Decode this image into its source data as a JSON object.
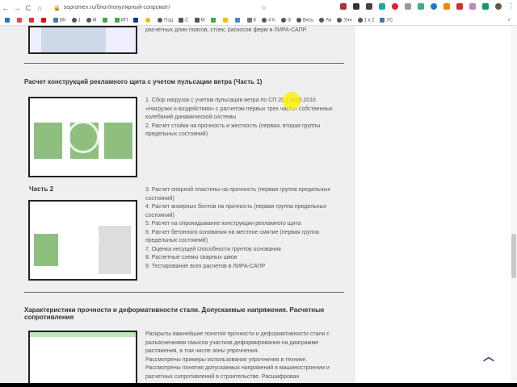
{
  "browser": {
    "url": "sopromex.ru/блог/популярный-сопромат/",
    "bookmarks": [
      "ВК",
      "J",
      "M",
      "ИП",
      "Под",
      "С",
      "М",
      "К",
      "4 К",
      "Э",
      "Весь",
      "Ав",
      "Унн",
      "1 к 2",
      "УС"
    ]
  },
  "sections": [
    {
      "tail_text": "расчетных длин поясов, стоек, раскосов ферм в ЛИРА-САПР."
    },
    {
      "title": "Расчет конструкций рекламного щита с учетом пульсации ветра (Часть 1)",
      "part1": [
        "1. Сбор нагрузок с учетом пульсации ветра по СП 20.13330.2016 «Нагрузки и воздействия» с расчетом первых трех частот собственных колебаний динамической системы",
        "2. Расчет стойки на прочность и жесткость (первая, вторая группы предельных состояний)"
      ],
      "part2_label": "Часть 2",
      "part2": [
        "3. Расчет опорной пластины на прочность (первая группа предельных состояний)",
        "4. Расчет анкерных болтов на прочность (первая группа предельных состояний)",
        "5. Расчет на опрокидывание конструкции рекламного щита",
        "6. Расчет бетонного основания на местное смятие (первая группа предельных состояний)",
        "7. Оценка несущей способности грунтов основания",
        "8. Расчетные схемы сварных швов",
        "9. Тестирование всех расчетов в ЛИРА-САПР"
      ]
    },
    {
      "title": "Характеристики прочности и деформативности стали. Допускаемые напряжения. Расчетные сопротивления",
      "text": [
        "Раскрыты важнейшие понятия прочности и деформативности стали с разъяснениями смысла участков деформирования на диаграмме растяжения, в том числе зоны упрочнения.",
        "Рассмотрены примеры использования упрочнения в технике.",
        "Рассмотрены понятия допускаемых напряжений в машиностроении и расчетных сопротивлений в строительстве. Расшифрован"
      ]
    }
  ]
}
